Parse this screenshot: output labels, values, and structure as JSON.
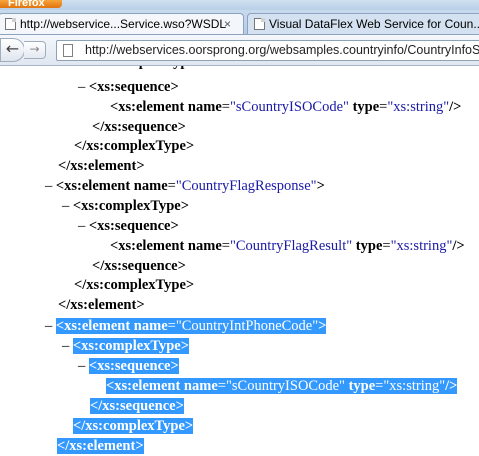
{
  "browser": {
    "app_button_label": "Firefox",
    "tabs": [
      {
        "title": "http://webservice...Service.wso?WSDL",
        "close": "×"
      },
      {
        "title": "Visual DataFlex Web Service for Coun..."
      }
    ],
    "url": "http://webservices.oorsprong.org/websamples.countryinfo/CountryInfoSe",
    "back_glyph": "🡨",
    "forward_glyph": "▶"
  },
  "xml": {
    "lines": [
      {
        "toggle": "–",
        "open": "<xs:sequence>"
      },
      {
        "open": "<xs:element",
        "attr1": "name",
        "val1": "sCountryISOCode",
        "attr2": "type",
        "val2": "xs:string",
        "close": "/>"
      },
      {
        "open": "</xs:sequence>"
      },
      {
        "open": "</xs:complexType>"
      },
      {
        "open": "</xs:element>"
      },
      {
        "toggle": "–",
        "open": "<xs:element",
        "attr1": "name",
        "val1": "CountryFlagResponse",
        "close": ">"
      },
      {
        "toggle": "–",
        "open": "<xs:complexType>"
      },
      {
        "toggle": "–",
        "open": "<xs:sequence>"
      },
      {
        "open": "<xs:element",
        "attr1": "name",
        "val1": "CountryFlagResult",
        "attr2": "type",
        "val2": "xs:string",
        "close": "/>"
      },
      {
        "open": "</xs:sequence>"
      },
      {
        "open": "</xs:complexType>"
      },
      {
        "open": "</xs:element>"
      },
      {
        "toggle": "–",
        "open": "<xs:element",
        "attr1": "name",
        "val1": "CountryIntPhoneCode",
        "close": ">"
      },
      {
        "toggle": "–",
        "open": "<xs:complexType>"
      },
      {
        "toggle": "–",
        "open": "<xs:sequence>"
      },
      {
        "open": "<xs:element",
        "attr1": "name",
        "val1": "sCountryISOCode",
        "attr2": "type",
        "val2": "xs:string",
        "close": "/>"
      },
      {
        "open": "</xs:sequence>"
      },
      {
        "open": "</xs:complexType>"
      },
      {
        "open": "</xs:element>"
      }
    ],
    "eq": "=",
    "quote": "\""
  }
}
